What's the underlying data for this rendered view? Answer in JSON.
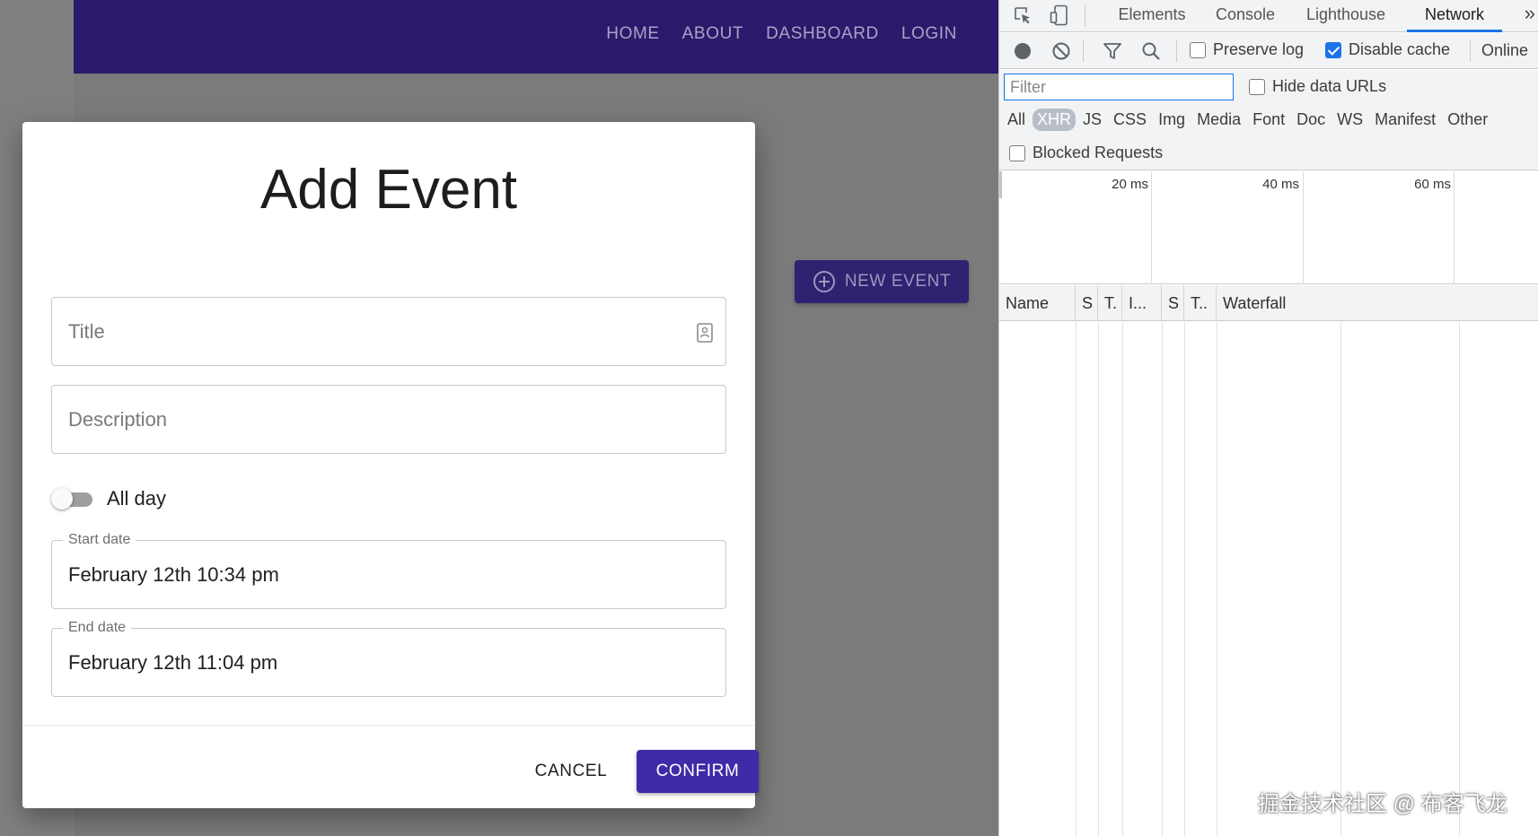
{
  "navbar": {
    "links": [
      "HOME",
      "ABOUT",
      "DASHBOARD",
      "LOGIN"
    ],
    "background": "#2b1a6b"
  },
  "page": {
    "new_event_label": "NEW EVENT"
  },
  "dialog": {
    "title": "Add Event",
    "title_field": {
      "placeholder": "Title",
      "value": ""
    },
    "description_field": {
      "placeholder": "Description",
      "value": ""
    },
    "all_day": {
      "label": "All day",
      "checked": false
    },
    "start_date": {
      "label": "Start date",
      "value": "February 12th 10:34 pm"
    },
    "end_date": {
      "label": "End date",
      "value": "February 12th 11:04 pm"
    },
    "cancel_label": "CANCEL",
    "confirm_label": "CONFIRM",
    "accent": "#3f2aa7"
  },
  "devtools": {
    "tabs": [
      "Elements",
      "Console",
      "Lighthouse",
      "Network"
    ],
    "active_tab": "Network",
    "more": "»",
    "toolbar": {
      "preserve_log": {
        "label": "Preserve log",
        "checked": false
      },
      "disable_cache": {
        "label": "Disable cache",
        "checked": true
      },
      "throttling": "Online"
    },
    "filter": {
      "placeholder": "Filter",
      "value": ""
    },
    "hide_data_urls": {
      "label": "Hide data URLs",
      "checked": false
    },
    "type_filters": [
      "All",
      "XHR",
      "JS",
      "CSS",
      "Img",
      "Media",
      "Font",
      "Doc",
      "WS",
      "Manifest",
      "Other"
    ],
    "active_type_filter": "XHR",
    "blocked_requests": {
      "label": "Blocked Requests",
      "checked": false
    },
    "overview_ticks": [
      "20 ms",
      "40 ms",
      "60 ms"
    ],
    "columns": [
      "Name",
      "S",
      "T.",
      "I...",
      "S",
      "T..",
      "Waterfall"
    ],
    "accent": "#1a73e8"
  },
  "watermark": "掘金技术社区 @ 布客飞龙"
}
